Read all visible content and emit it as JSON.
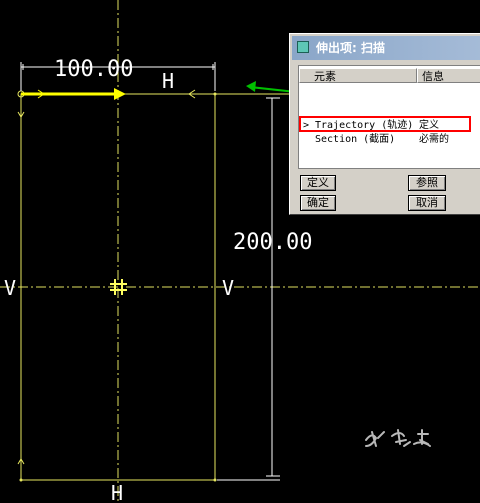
{
  "sketch": {
    "dim_width": "100.00",
    "dim_height": "200.00",
    "label_h_top": "H",
    "label_h_bottom": "H",
    "label_v_left": "V",
    "label_v_right": "V",
    "colors": {
      "background": "#000000",
      "geometry": "#e8e860",
      "centerline": "#e0e060",
      "dimension": "#ffffff",
      "start_arrow": "#ffff00",
      "pointer_arrow": "#00c000"
    }
  },
  "dialog": {
    "title": "伸出项: 扫描",
    "columns": [
      "元素",
      "信息"
    ],
    "rows": [
      {
        "element": "Trajectory (轨迹)",
        "info": "定义",
        "selected": true
      },
      {
        "element": "Section (截面)",
        "info": "必需的",
        "selected": false
      }
    ],
    "buttons": {
      "define": "定义",
      "refs": "参照",
      "ok": "确定",
      "cancel": "取消"
    }
  },
  "watermark": "水骆驼"
}
